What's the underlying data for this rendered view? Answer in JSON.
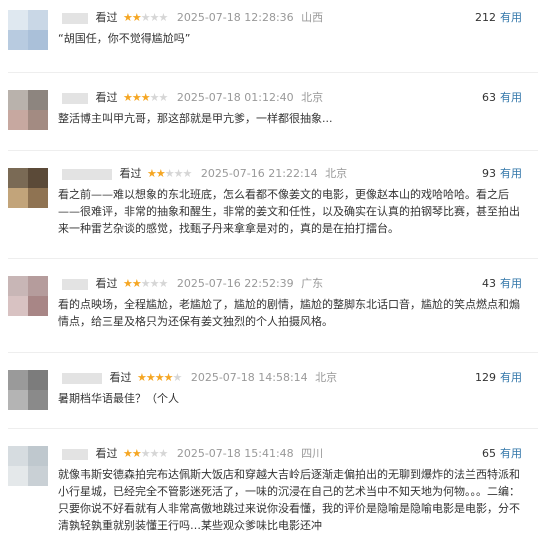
{
  "reviews": [
    {
      "seen": "看过",
      "rating": 2,
      "time": "2025-07-18 12:28:36",
      "location": "山西",
      "useful_count": "212",
      "useful_label": "有用",
      "content": "“胡国任，你不觉得尴尬吗”",
      "avatar_colors": [
        "#dfe8f0",
        "#c9d7e6",
        "#b8cbe0",
        "#aac0d9"
      ]
    },
    {
      "seen": "看过",
      "rating": 3,
      "time": "2025-07-18 01:12:40",
      "location": "北京",
      "useful_count": "63",
      "useful_label": "有用",
      "content": "整活博主叫甲亢哥，那这部就是甲亢爹，一样都很抽象...",
      "avatar_colors": [
        "#b9b2ac",
        "#8d857f",
        "#c7a8a0",
        "#a38b82"
      ]
    },
    {
      "seen": "看过",
      "rating": 2,
      "time": "2025-07-16 21:22:14",
      "location": "北京",
      "useful_count": "93",
      "useful_label": "有用",
      "content": "看之前——难以想象的东北班底，怎么看都不像姜文的电影，更像赵本山的戏哈哈哈。看之后——很难评，非常的抽象和醒生，非常的姜文和任性，以及确实在认真的拍钢琴比赛，甚至拍出来一种雷艺杂谈的感觉，找甄子丹来拿拿是对的，真的是在拍打擂台。",
      "avatar_colors": [
        "#7a6a55",
        "#5b4a38",
        "#c2a47a",
        "#8f7352"
      ]
    },
    {
      "seen": "看过",
      "rating": 2,
      "time": "2025-07-16 22:52:39",
      "location": "广东",
      "useful_count": "43",
      "useful_label": "有用",
      "content": "看的点映场，全程尴尬，老尴尬了，尴尬的剧情，尴尬的整脚东北话口音，尴尬的笑点燃点和煽情点，给三星及格只为还保有姜文独烈的个人拍摄风格。",
      "avatar_colors": [
        "#c8b6b6",
        "#b59c9c",
        "#d8c2c2",
        "#a88686"
      ]
    },
    {
      "seen": "看过",
      "rating": 4,
      "time": "2025-07-18 14:58:14",
      "location": "北京",
      "useful_count": "129",
      "useful_label": "有用",
      "content": "暑期档华语最佳？（个人",
      "avatar_colors": [
        "#9a9a9a",
        "#7c7c7c",
        "#b4b4b4",
        "#8a8a8a"
      ]
    },
    {
      "seen": "看过",
      "rating": 2,
      "time": "2025-07-18 15:41:48",
      "location": "四川",
      "useful_count": "65",
      "useful_label": "有用",
      "content": "就像韦斯安德森拍完布达佩斯大饭店和穿越大吉岭后逐渐走偏拍出的无聊到爆炸的法兰西特派和小行星城，已经完全不管影迷死活了，一味的沉浸在自己的艺术当中不知天地为何物。。。二编：只要你说不好看就有人非常高傲地跳过来说你没看懂，我的评价是隐喻是隐喻电影是电影，分不清孰轻孰重就别装懂王行吗…某些观众爹味比电影还冲",
      "avatar_colors": [
        "#d6dce0",
        "#bfc8ce",
        "#e4e8ea",
        "#c9d0d5"
      ]
    }
  ]
}
